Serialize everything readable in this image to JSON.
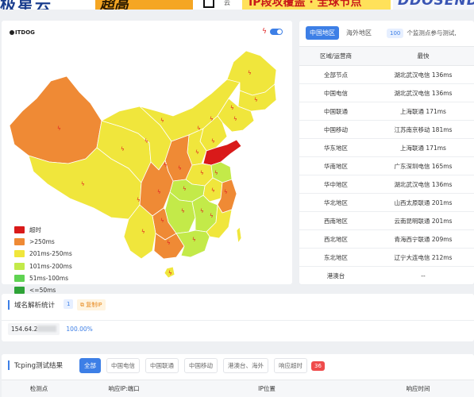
{
  "banner": {
    "left_text": "极星云",
    "orange_text": "超高",
    "small_text": "云",
    "yellow_text": "IP段攻覆盖 · 全球节点",
    "right_text": "DDOSEND"
  },
  "map": {
    "logo_text": "ITDOG",
    "legend": [
      {
        "label": "超时",
        "color": "#d91a1a"
      },
      {
        "label": ">250ms",
        "color": "#ef8a35"
      },
      {
        "label": "201ms-250ms",
        "color": "#f0e63c"
      },
      {
        "label": "101ms-200ms",
        "color": "#c3ea49"
      },
      {
        "label": "51ms-100ms",
        "color": "#5fd352"
      },
      {
        "label": "<=50ms",
        "color": "#2ea337"
      }
    ]
  },
  "stats_panel": {
    "tab_mainland": "中国地区",
    "tab_overseas": "海外地区",
    "count_badge": "100",
    "count_note": "个监测点参与测试,",
    "header_region": "区域/运营商",
    "header_fastest": "最快",
    "rows": [
      {
        "region": "全部节点",
        "fastest": "湖北武汉电信 136ms"
      },
      {
        "region": "中国电信",
        "fastest": "湖北武汉电信 136ms"
      },
      {
        "region": "中国联通",
        "fastest": "上海联通 171ms"
      },
      {
        "region": "中国移动",
        "fastest": "江苏南京移动 181ms"
      },
      {
        "region": "华东地区",
        "fastest": "上海联通 171ms"
      },
      {
        "region": "华南地区",
        "fastest": "广东深圳电信 165ms"
      },
      {
        "region": "华中地区",
        "fastest": "湖北武汉电信 136ms"
      },
      {
        "region": "华北地区",
        "fastest": "山西太原联通 201ms"
      },
      {
        "region": "西南地区",
        "fastest": "云南昆明联通 201ms"
      },
      {
        "region": "西北地区",
        "fastest": "青海西宁联通 209ms"
      },
      {
        "region": "东北地区",
        "fastest": "辽宁大连电信 212ms"
      },
      {
        "region": "港澳台",
        "fastest": "--"
      }
    ]
  },
  "dns": {
    "title": "域名解析统计",
    "badge": "1",
    "copy_label": "复制IP",
    "ip_prefix": "154.64.2",
    "percent": "100.00%"
  },
  "tcping": {
    "title": "Tcping测试结果",
    "filters": [
      "全部",
      "中国电信",
      "中国联通",
      "中国移动",
      "港澳台、海外",
      "响应超时"
    ],
    "timeout_count": "36",
    "columns": [
      "检测点",
      "响应IP:端口",
      "IP位置",
      "响应时间"
    ]
  },
  "colors": {
    "accent": "#3d7fe6",
    "timeout": "#d91a1a",
    "over250": "#ef8a35",
    "mid": "#f0e63c",
    "good": "#c3ea49"
  }
}
